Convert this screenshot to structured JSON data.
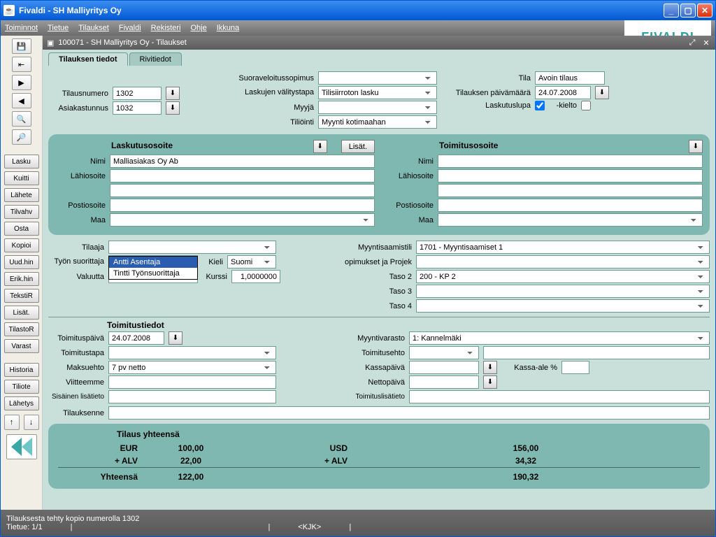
{
  "window": {
    "title": "Fivaldi - SH Malliyritys Oy"
  },
  "brand": "FIVALDI",
  "menubar": [
    "Toiminnot",
    "Tietue",
    "Tilaukset",
    "Fivaldi",
    "Rekisteri",
    "Ohje",
    "Ikkuna"
  ],
  "subwindow": {
    "title": "100071 - SH Malliyritys Oy - Tilaukset"
  },
  "tabs": {
    "active": "Tilauksen tiedot",
    "other": "Rivitiedot"
  },
  "sidebuttons": [
    "Lasku",
    "Kuitti",
    "Lähete",
    "Tilvahv",
    "Osta",
    "Kopioi",
    "Uud.hin",
    "Erik.hin",
    "TekstiR",
    "Lisät.",
    "TilastoR",
    "Varast",
    "Historia",
    "Tiliote",
    "Lähetys"
  ],
  "top": {
    "suoraveloitus_lbl": "Suoraveloitussopimus",
    "laskujen_valitystapa_lbl": "Laskujen välitystapa",
    "laskujen_valitystapa_val": "Tilisiirroton lasku",
    "myyja_lbl": "Myyjä",
    "tiliointi_lbl": "Tiliöinti",
    "tiliointi_val": "Myynti kotimaahan",
    "tilausnumero_lbl": "Tilausnumero",
    "tilausnumero_val": "1302",
    "asiakastunnus_lbl": "Asiakastunnus",
    "asiakastunnus_val": "1032",
    "tila_lbl": "Tila",
    "tila_val": "Avoin tilaus",
    "tilaus_pvm_lbl": "Tilauksen päivämäärä",
    "tilaus_pvm_val": "24.07.2008",
    "laskutuslupa_lbl": "Laskutuslupa",
    "kielto_lbl": "-kielto"
  },
  "addr": {
    "laskutus_title": "Laskutusosoite",
    "toimitus_title": "Toimitusosoite",
    "lisat_btn": "Lisät.",
    "nimi_lbl": "Nimi",
    "nimi_val": "Malliasiakas Oy Ab",
    "lahiosoite_lbl": "Lähiosoite",
    "postiosoite_lbl": "Postiosoite",
    "maa_lbl": "Maa"
  },
  "mid": {
    "tilaaja_lbl": "Tilaaja",
    "tyonsuorittaja_lbl": "Työn suorittaja",
    "valuutta_lbl": "Valuutta",
    "kieli_lbl": "Kieli",
    "kieli_val": "Suomi",
    "kurssi_lbl": "Kurssi",
    "kurssi_val": "1,0000000",
    "myyntisaamistili_lbl": "Myyntisaamistili",
    "myyntisaamistili_val": "1701 - Myyntisaamiset 1",
    "sopimukset_lbl": "opimukset ja Projek",
    "taso2_lbl": "Taso 2",
    "taso2_val": "200 - KP 2",
    "taso3_lbl": "Taso 3",
    "taso4_lbl": "Taso 4",
    "dropdown_sel": "Antti Asentaja",
    "dropdown_opt": "Tintti Työnsuorittaja"
  },
  "deliv": {
    "title": "Toimitustiedot",
    "toimituspaiva_lbl": "Toimituspäivä",
    "toimituspaiva_val": "24.07.2008",
    "toimitustapa_lbl": "Toimitustapa",
    "maksuehto_lbl": "Maksuehto",
    "maksuehto_val": "7 pv netto",
    "viitteemme_lbl": "Viitteemme",
    "sisainen_lbl": "Sisäinen lisätieto",
    "tilauksenne_lbl": "Tilauksenne",
    "myyntivarasto_lbl": "Myyntivarasto",
    "myyntivarasto_val": "1: Kannelmäki",
    "toimitusehto_lbl": "Toimitusehto",
    "kassapaiva_lbl": "Kassapäivä",
    "kassa_ale_lbl": "Kassa-ale %",
    "nettopaiva_lbl": "Nettopäivä",
    "toimituslisatieto_lbl": "Toimituslisätieto"
  },
  "totals": {
    "title": "Tilaus yhteensä",
    "eur_lbl": "EUR",
    "eur_val": "100,00",
    "alv_lbl": "+ ALV",
    "eur_alv": "22,00",
    "yht_lbl": "Yhteensä",
    "eur_total": "122,00",
    "usd_lbl": "USD",
    "usd_val": "156,00",
    "usd_alv": "34,32",
    "usd_total": "190,32"
  },
  "status": {
    "msg": "Tilauksesta tehty kopio numerolla 1302",
    "tietue": "Tietue: 1/1",
    "user": "<KJK>"
  }
}
